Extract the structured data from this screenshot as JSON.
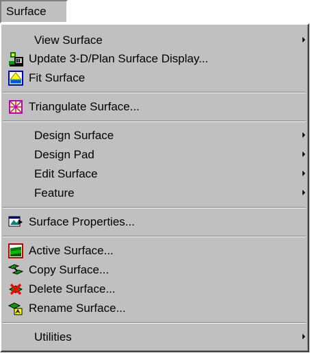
{
  "menubar": {
    "title": "Surface"
  },
  "menu": {
    "items": [
      {
        "label": "View Surface",
        "submenu": true,
        "icon": null
      },
      {
        "label": "Update 3-D/Plan Surface Display...",
        "submenu": false,
        "icon": "update-display-icon"
      },
      {
        "label": "Fit Surface",
        "submenu": false,
        "icon": "fit-surface-icon"
      },
      {
        "label": "Triangulate Surface...",
        "submenu": false,
        "icon": "triangulate-icon"
      },
      {
        "label": "Design Surface",
        "submenu": true,
        "icon": null
      },
      {
        "label": "Design Pad",
        "submenu": true,
        "icon": null
      },
      {
        "label": "Edit Surface",
        "submenu": true,
        "icon": null
      },
      {
        "label": "Feature",
        "submenu": true,
        "icon": null
      },
      {
        "label": "Surface Properties...",
        "submenu": false,
        "icon": "surface-properties-icon"
      },
      {
        "label": "Active Surface...",
        "submenu": false,
        "icon": "active-surface-icon"
      },
      {
        "label": "Copy Surface...",
        "submenu": false,
        "icon": "copy-surface-icon"
      },
      {
        "label": "Delete Surface...",
        "submenu": false,
        "icon": "delete-surface-icon"
      },
      {
        "label": "Rename Surface...",
        "submenu": false,
        "icon": "rename-surface-icon"
      },
      {
        "label": "Utilities",
        "submenu": true,
        "icon": null
      }
    ]
  },
  "colors": {
    "face": "#c0c0c0",
    "shadow": "#808080",
    "highlight": "#ffffff"
  }
}
